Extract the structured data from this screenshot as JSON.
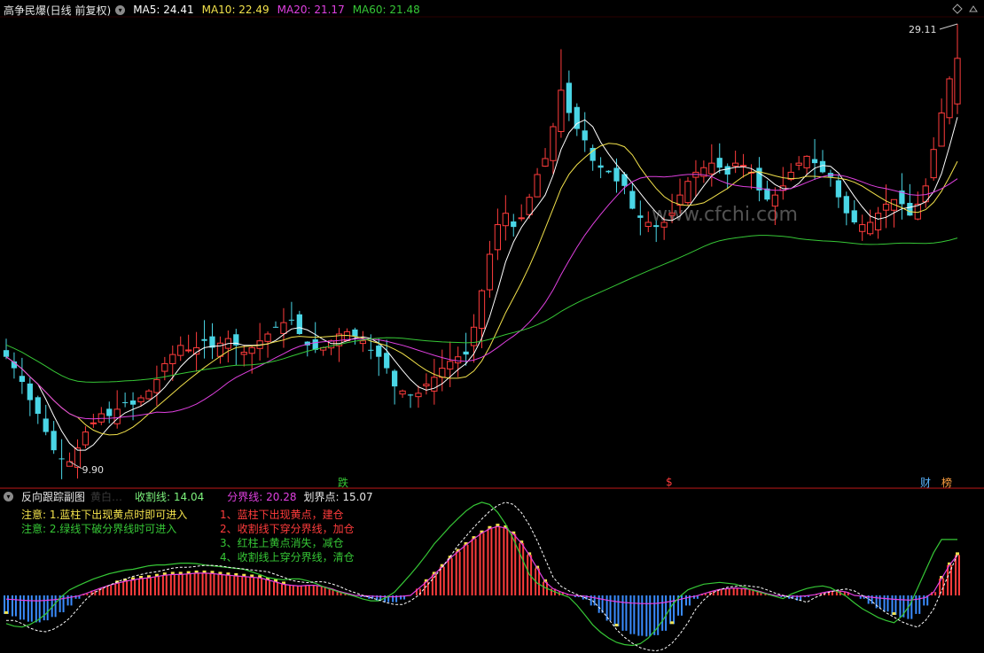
{
  "main_header": {
    "title": "高争民爆(日线 前复权)",
    "ma5": "MA5: 24.41",
    "ma10": "MA10: 22.49",
    "ma20": "MA20: 21.17",
    "ma60": "MA60: 21.48"
  },
  "sub_header": {
    "title": "反向跟踪副图",
    "dim": "黄白…",
    "shouge": "收割线: 14.04",
    "fenjie": "分界线: 20.28",
    "huajie": "划界点: 15.07"
  },
  "notes_left": [
    "注意: 1.蓝柱下出现黄点时即可进入",
    "注意: 2.绿线下破分界线时可进入"
  ],
  "notes_right": [
    "1、蓝柱下出现黄点，建仓",
    "2、收割线下穿分界线，加仓",
    "3、红柱上黄点消失，减仓",
    "4、收割线上穿分界线，清仓"
  ],
  "markers": {
    "die": "跌",
    "s": "$",
    "cai": "财",
    "bang": "榜"
  },
  "watermark": "www.cfchi.com",
  "colors": {
    "up": "#ff3c3c",
    "down": "#4ad6e6",
    "ma5": "#ffffff",
    "ma10": "#f2e14b",
    "ma20": "#e040e0",
    "ma60": "#36c736",
    "frame": "#c01818",
    "note_left": "#f2e14b",
    "note_right": "#ff3c3c"
  },
  "chart_data": [
    {
      "type": "candlestick",
      "title": "高争民爆(日线 前复权)",
      "price_range": [
        9.9,
        29.11
      ],
      "annotations": [
        {
          "label": "9.90",
          "type": "low"
        },
        {
          "label": "29.11",
          "type": "high"
        }
      ],
      "ohlc_close": [
        14.5,
        14.0,
        13.4,
        12.6,
        12.0,
        11.2,
        10.4,
        10.0,
        9.9,
        10.5,
        11.2,
        11.6,
        12.0,
        11.9,
        12.2,
        12.5,
        12.4,
        12.7,
        13.0,
        13.5,
        14.2,
        14.6,
        15.0,
        14.8,
        14.9,
        15.2,
        14.9,
        15.1,
        15.3,
        15.0,
        14.7,
        14.9,
        15.2,
        15.5,
        15.8,
        16.0,
        16.1,
        15.5,
        15.0,
        14.8,
        14.9,
        15.2,
        15.5,
        15.6,
        15.4,
        15.2,
        14.8,
        14.5,
        14.0,
        13.2,
        13.0,
        12.8,
        12.9,
        13.3,
        13.6,
        14.0,
        14.3,
        14.5,
        14.6,
        15.8,
        17.4,
        19.0,
        20.3,
        20.8,
        20.2,
        20.6,
        21.5,
        22.5,
        23.2,
        24.6,
        26.2,
        25.2,
        24.5,
        24.0,
        23.1,
        22.8,
        22.6,
        22.2,
        22.0,
        21.0,
        20.6,
        20.4,
        20.2,
        20.4,
        20.8,
        21.6,
        22.2,
        22.6,
        22.8,
        23.0,
        22.8,
        22.5,
        23.0,
        22.9,
        22.6,
        21.8,
        21.4,
        21.6,
        22.0,
        22.6,
        23.0,
        23.3,
        23.0,
        22.6,
        22.4,
        21.5,
        20.8,
        20.4,
        20.3,
        20.4,
        20.8,
        21.2,
        21.4,
        21.2,
        20.7,
        21.2,
        22.0,
        23.6,
        25.2,
        26.7,
        27.6
      ],
      "moving_averages": [
        {
          "name": "MA5",
          "last": 24.41
        },
        {
          "name": "MA10",
          "last": 22.49
        },
        {
          "name": "MA20",
          "last": 21.17
        },
        {
          "name": "MA60",
          "last": 21.48
        }
      ]
    },
    {
      "type": "bar",
      "title": "反向跟踪副图",
      "series_last": {
        "收割线": 14.04,
        "分界线": 20.28,
        "划界点": 15.07
      },
      "values": [
        -0.55,
        -0.62,
        -0.72,
        -0.78,
        -0.8,
        -0.74,
        -0.64,
        -0.5,
        -0.3,
        -0.1,
        0.05,
        0.14,
        0.22,
        0.3,
        0.36,
        0.42,
        0.46,
        0.5,
        0.52,
        0.56,
        0.6,
        0.62,
        0.62,
        0.64,
        0.66,
        0.66,
        0.65,
        0.62,
        0.6,
        0.58,
        0.56,
        0.54,
        0.52,
        0.46,
        0.4,
        0.33,
        0.3,
        0.28,
        0.3,
        0.3,
        0.26,
        0.2,
        0.12,
        0.06,
        0.0,
        -0.05,
        -0.1,
        -0.16,
        -0.2,
        -0.2,
        -0.12,
        0.0,
        0.2,
        0.4,
        0.62,
        0.85,
        1.1,
        1.3,
        1.5,
        1.68,
        1.85,
        1.98,
        2.05,
        2.0,
        1.82,
        1.55,
        1.2,
        0.8,
        0.4,
        0.2,
        0.1,
        0.02,
        -0.05,
        -0.12,
        -0.3,
        -0.52,
        -0.75,
        -0.92,
        -1.05,
        -1.15,
        -1.2,
        -1.22,
        -1.18,
        -1.05,
        -0.85,
        -0.6,
        -0.3,
        -0.1,
        0.05,
        0.12,
        0.18,
        0.2,
        0.22,
        0.2,
        0.18,
        0.12,
        0.05,
        0.0,
        -0.05,
        -0.1,
        -0.15,
        -0.05,
        0.02,
        0.08,
        0.12,
        0.14,
        0.1,
        0.0,
        -0.1,
        -0.25,
        -0.38,
        -0.48,
        -0.58,
        -0.65,
        -0.7,
        -0.55,
        -0.3,
        0.1,
        0.5,
        0.9,
        1.2
      ],
      "yellow_dot_note": "蓝柱下出现黄点"
    }
  ]
}
